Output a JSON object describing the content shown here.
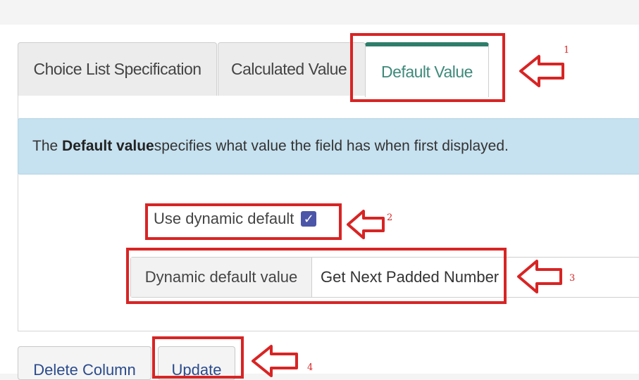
{
  "tabs": [
    {
      "label": "Choice List Specification",
      "active": false
    },
    {
      "label": "Calculated Value",
      "active": false
    },
    {
      "label": "Default Value",
      "active": true
    }
  ],
  "info": {
    "prefix": "The ",
    "bold": "Default value",
    "suffix": " specifies what value the field has when first displayed."
  },
  "dynamic_default": {
    "label": "Use dynamic default",
    "checked": true
  },
  "dynamic_value": {
    "label": "Dynamic default value",
    "value": "Get Next Padded Number"
  },
  "buttons": {
    "delete": "Delete Column",
    "update": "Update"
  },
  "annotations": [
    "1",
    "2",
    "3",
    "4"
  ],
  "colors": {
    "annotation_red": "#d82424",
    "active_tab_accent": "#2e7d6b",
    "info_background": "#c6e1ef",
    "checkbox": "#4b56a8"
  }
}
